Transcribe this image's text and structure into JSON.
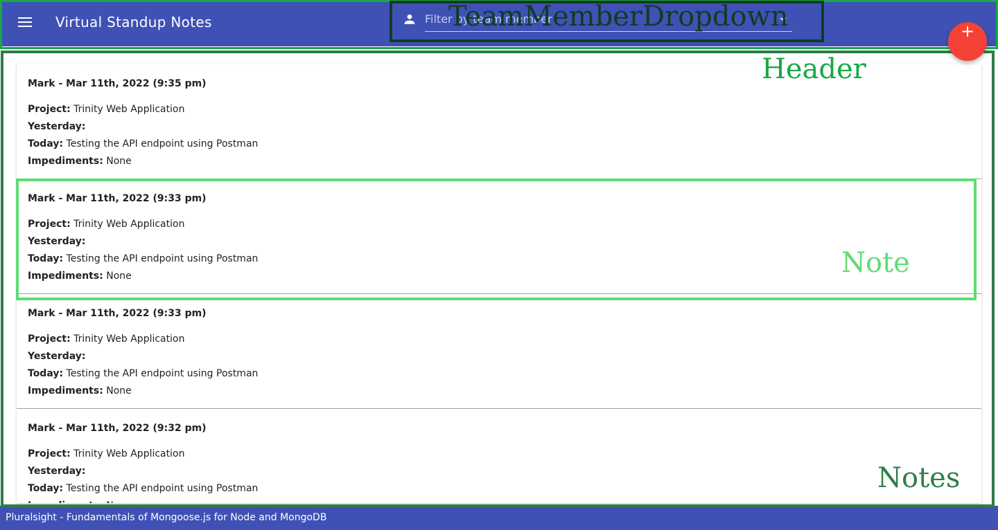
{
  "header": {
    "title": "Virtual Standup Notes",
    "filter_placeholder": "Filter by team member",
    "fab_label": "+"
  },
  "annotations": {
    "team_member_dropdown": "TeamMemberDropdown",
    "header": "Header",
    "note": "Note",
    "notes": "Notes"
  },
  "labels": {
    "project": "Project:",
    "yesterday": "Yesterday:",
    "today": "Today:",
    "impediments": "Impediments:"
  },
  "notes": [
    {
      "title": "Mark - Mar 11th, 2022 (9:35 pm)",
      "project": "Trinity Web Application",
      "yesterday": "",
      "today": "Testing the API endpoint using Postman",
      "impediments": "None"
    },
    {
      "title": "Mark - Mar 11th, 2022 (9:33 pm)",
      "project": "Trinity Web Application",
      "yesterday": "",
      "today": "Testing the API endpoint using Postman",
      "impediments": "None"
    },
    {
      "title": "Mark - Mar 11th, 2022 (9:33 pm)",
      "project": "Trinity Web Application",
      "yesterday": "",
      "today": "Testing the API endpoint using Postman",
      "impediments": "None"
    },
    {
      "title": "Mark - Mar 11th, 2022 (9:32 pm)",
      "project": "Trinity Web Application",
      "yesterday": "",
      "today": "Testing the API endpoint using Postman",
      "impediments": "None"
    }
  ],
  "footer": {
    "text": "Pluralsight - Fundamentals of Mongoose.js for Node and MongoDB"
  },
  "colors": {
    "primary": "#3f51b5",
    "accent": "#f44336"
  }
}
